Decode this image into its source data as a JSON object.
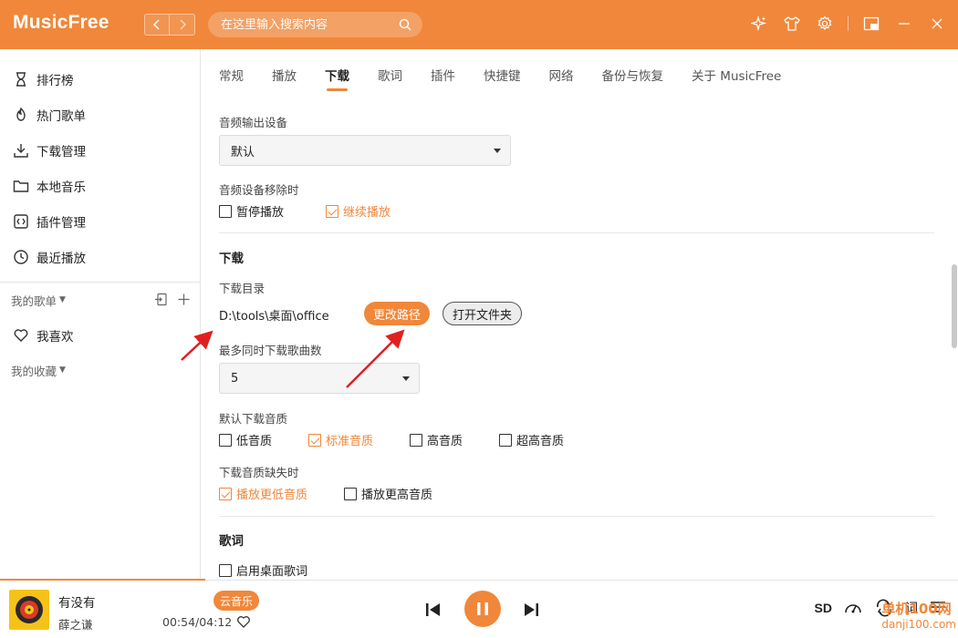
{
  "app": {
    "logo": "MusicFree"
  },
  "search": {
    "placeholder": "在这里输入搜索内容"
  },
  "sidebar": {
    "items": [
      {
        "label": "排行榜",
        "icon": "hourglass-icon"
      },
      {
        "label": "热门歌单",
        "icon": "fire-icon"
      },
      {
        "label": "下载管理",
        "icon": "download-icon"
      },
      {
        "label": "本地音乐",
        "icon": "folder-icon"
      },
      {
        "label": "插件管理",
        "icon": "plugin-icon"
      },
      {
        "label": "最近播放",
        "icon": "clock-icon"
      }
    ],
    "my_playlists": "我的歌单",
    "favorite": "我喜欢",
    "my_collections": "我的收藏"
  },
  "tabs": [
    "常规",
    "播放",
    "下载",
    "歌词",
    "插件",
    "快捷键",
    "网络",
    "备份与恢复",
    "关于 MusicFree"
  ],
  "active_tab": "下载",
  "settings": {
    "audio_output_label": "音频输出设备",
    "audio_output_value": "默认",
    "device_removed_label": "音频设备移除时",
    "device_removed_options": [
      {
        "label": "暂停播放",
        "checked": false
      },
      {
        "label": "继续播放",
        "checked": true
      }
    ],
    "download_section": "下载",
    "download_dir_label": "下载目录",
    "download_dir_value": "D:\\tools\\桌面\\office",
    "change_path_button": "更改路径",
    "open_folder_button": "打开文件夹",
    "max_concurrent_label": "最多同时下载歌曲数",
    "max_concurrent_value": "5",
    "default_quality_label": "默认下载音质",
    "quality_options": [
      {
        "label": "低音质",
        "checked": false
      },
      {
        "label": "标准音质",
        "checked": true
      },
      {
        "label": "高音质",
        "checked": false
      },
      {
        "label": "超高音质",
        "checked": false
      }
    ],
    "missing_quality_label": "下载音质缺失时",
    "missing_quality_options": [
      {
        "label": "播放更低音质",
        "checked": true
      },
      {
        "label": "播放更高音质",
        "checked": false
      }
    ],
    "lyrics_section": "歌词",
    "desktop_lyrics": {
      "label": "启用桌面歌词",
      "checked": false
    }
  },
  "player": {
    "title": "有没有",
    "artist": "薛之谦",
    "source": "云音乐",
    "time": "00:54/04:12",
    "quality": "SD",
    "lyric_label": "词",
    "progress": 0.214
  },
  "watermark": {
    "site": "danji100.com",
    "brand": "单机100网"
  },
  "colors": {
    "accent": "#f0873a",
    "annotation_arrow": "#e02020"
  }
}
